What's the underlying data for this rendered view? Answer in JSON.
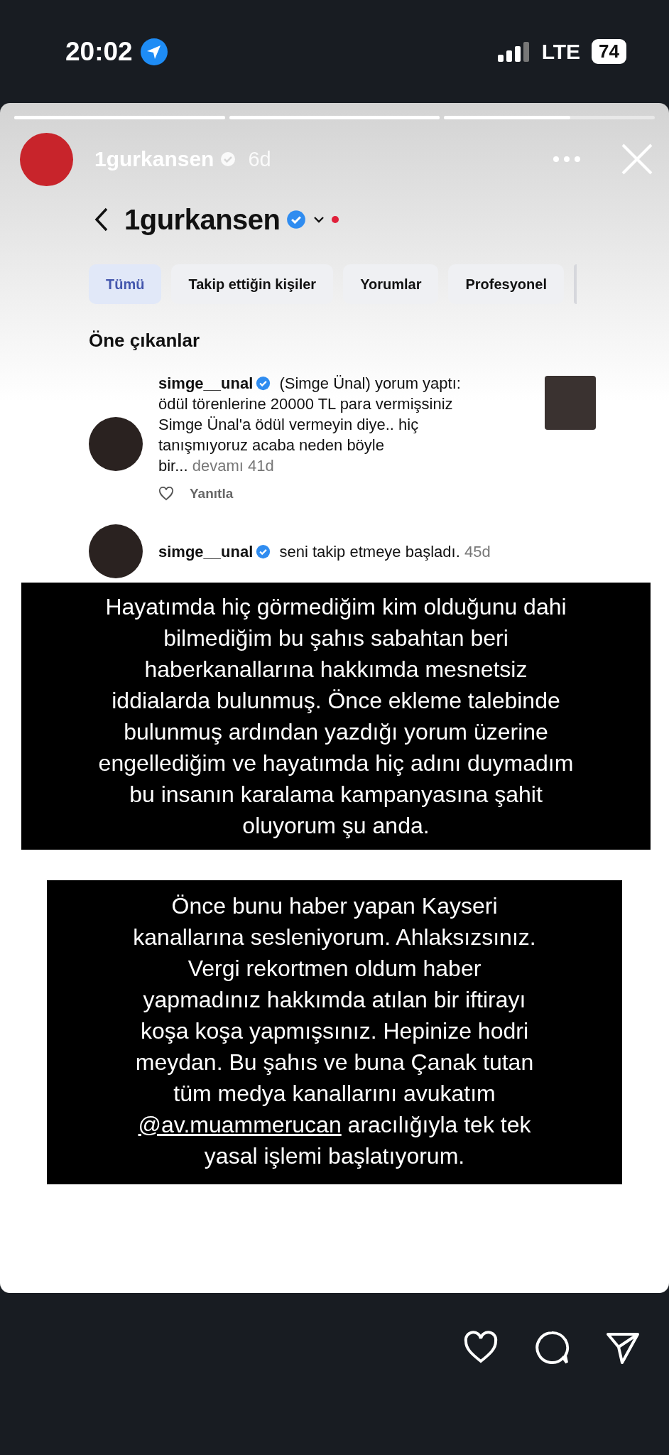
{
  "status_bar": {
    "time": "20:02",
    "network": "LTE",
    "battery": "74"
  },
  "story": {
    "progress": [
      {
        "level": 1
      },
      {
        "level": 1
      },
      {
        "level": 0.6
      }
    ],
    "username": "1gurkansen",
    "verified": true,
    "age": "6d"
  },
  "screenshot": {
    "title": "1gurkansen",
    "verified": true,
    "tabs": [
      {
        "label": "Tümü",
        "selected": true
      },
      {
        "label": "Takip ettiğin kişiler",
        "selected": false
      },
      {
        "label": "Yorumlar",
        "selected": false
      },
      {
        "label": "Profesyonel",
        "selected": false
      }
    ],
    "section_title": "Öne çıkanlar",
    "notifications": [
      {
        "kind": "comment",
        "username": "simge__unal",
        "verified": true,
        "action": "(Simge Ünal) yorum yaptı:",
        "text": "ödül törenlerine 20000 TL para vermişsiniz\nSimge Ünal'a ödül vermeyin diye.. hiç\ntanışmıyoruz acaba neden böyle",
        "text_end": "bir...",
        "more": "devamı",
        "time": "41d",
        "reply": "Yanıtla"
      },
      {
        "kind": "follow",
        "username": "simge__unal",
        "verified": true,
        "text": "seni takip etmeye başladı.",
        "time": "45d"
      }
    ]
  },
  "captions": [
    {
      "kind": "plain",
      "text": "Hayatımda hiç görmediğim kim olduğunu dahi\nbilmediğim bu şahıs sabahtan beri\nhaberkanallarına hakkımda mesnetsiz\niddialarda bulunmuş. Önce ekleme talebinde\nbulunmuş ardından yazdığı yorum üzerine\nengellediğim ve hayatımda hiç adını duymadım\nbu insanın karalama kampanyasına şahit\noluyorum şu anda."
    },
    {
      "kind": "mention",
      "text_before": "Önce bunu haber yapan Kayseri\nkanallarına sesleniyorum. Ahlaksızsınız.\nVergi rekortmen oldum haber\nyapmadınız hakkımda atılan bir iftirayı\nkoşa koşa yapmışsınız. Hepinize hodri\nmeydan. Bu şahıs ve buna Çanak tutan\ntüm medya kanallarını avukatım\n",
      "mention": "@av.muammerucan",
      "text_after": " aracılığıyla tek tek\nyasal işlemi başlatıyorum."
    }
  ]
}
